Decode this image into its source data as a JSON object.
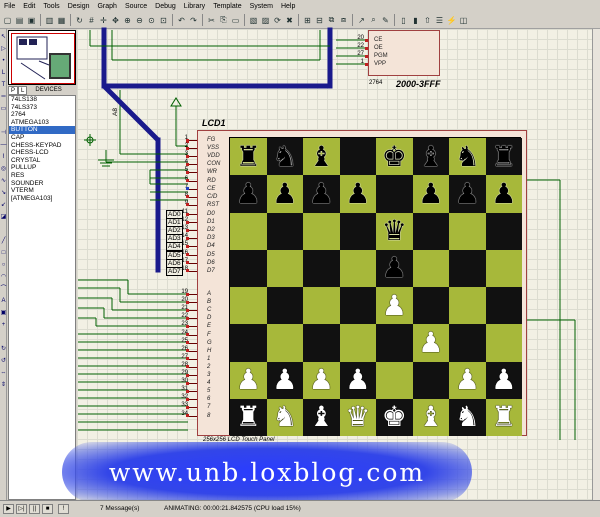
{
  "menu": [
    "File",
    "Edit",
    "Tools",
    "Design",
    "Graph",
    "Source",
    "Debug",
    "Library",
    "Template",
    "System",
    "Help"
  ],
  "device_panel": {
    "tab_p": "P",
    "tab_l": "L",
    "header": "DEVICES",
    "items": [
      "74LS138",
      "74LS373",
      "2764",
      "ATMEGA103",
      "BUTTON",
      "CAP",
      "CHESS-KEYPAD",
      "CHESS-LCD",
      "CRYSTAL",
      "PULLUP",
      "RES",
      "SOUNDER",
      "VTERM",
      "[ATMEGA103]"
    ],
    "selected_index": 4
  },
  "lcd": {
    "ref": "LCD1",
    "caption": "256x256 LCD Touch Panel",
    "left_pins": [
      {
        "num": "1",
        "name": "FG"
      },
      {
        "num": "2",
        "name": "VSS"
      },
      {
        "num": "3",
        "name": "VDD"
      },
      {
        "num": "4",
        "name": "CON"
      },
      {
        "num": "5",
        "name": "WR"
      },
      {
        "num": "6",
        "name": "RD"
      },
      {
        "num": "7",
        "name": "CE"
      },
      {
        "num": "8",
        "name": "C/D"
      },
      {
        "num": "9",
        "name": "RST"
      },
      {
        "num": "11",
        "name": "D0"
      },
      {
        "num": "12",
        "name": "D1"
      },
      {
        "num": "13",
        "name": "D2"
      },
      {
        "num": "14",
        "name": "D3"
      },
      {
        "num": "15",
        "name": "D4"
      },
      {
        "num": "16",
        "name": "D5"
      },
      {
        "num": "17",
        "name": "D6"
      },
      {
        "num": "18",
        "name": "D7"
      },
      {
        "num": "19",
        "name": "A"
      },
      {
        "num": "20",
        "name": "B"
      },
      {
        "num": "21",
        "name": "C"
      },
      {
        "num": "22",
        "name": "D"
      },
      {
        "num": "23",
        "name": "E"
      },
      {
        "num": "24",
        "name": "F"
      },
      {
        "num": "25",
        "name": "G"
      },
      {
        "num": "26",
        "name": "H"
      },
      {
        "num": "27",
        "name": "1"
      },
      {
        "num": "28",
        "name": "2"
      },
      {
        "num": "29",
        "name": "3"
      },
      {
        "num": "30",
        "name": "4"
      },
      {
        "num": "31",
        "name": "5"
      },
      {
        "num": "32",
        "name": "6"
      },
      {
        "num": "33",
        "name": "7"
      },
      {
        "num": "34",
        "name": "8"
      }
    ],
    "data_nets": [
      "AD0",
      "AD1",
      "AD2",
      "AD3",
      "AD4",
      "AD5",
      "AD6",
      "AD7"
    ],
    "board": [
      [
        "br",
        "bn",
        "bb",
        "",
        "bk",
        "bb",
        "bn",
        "br"
      ],
      [
        "bp",
        "bp",
        "bp",
        "bp",
        "",
        "bp",
        "bp",
        "bp"
      ],
      [
        "",
        "",
        "",
        "",
        "bq",
        "",
        "",
        ""
      ],
      [
        "",
        "",
        "",
        "",
        "bp",
        "",
        "",
        ""
      ],
      [
        "",
        "",
        "",
        "",
        "wp",
        "",
        "",
        ""
      ],
      [
        "",
        "",
        "",
        "",
        "",
        "wp",
        "",
        ""
      ],
      [
        "wp",
        "wp",
        "wp",
        "wp",
        "",
        "",
        "wp",
        "wp"
      ],
      [
        "wr",
        "wn",
        "wb",
        "wq",
        "wk",
        "wb",
        "wn",
        "wr"
      ]
    ]
  },
  "eprom": {
    "name": "2000-3FFF",
    "part": "2764",
    "pins": [
      {
        "num": "20",
        "name": "CE"
      },
      {
        "num": "22",
        "name": "OE"
      },
      {
        "num": "27",
        "name": "PGM"
      },
      {
        "num": "1",
        "name": "VPP"
      }
    ]
  },
  "net_a8": "A8",
  "watermark": "www.unb.loxblog.com",
  "status": {
    "messages": "7 Message(s)",
    "sim": "ANIMATING: 00:00:21.842575 (CPU load 15%)"
  }
}
